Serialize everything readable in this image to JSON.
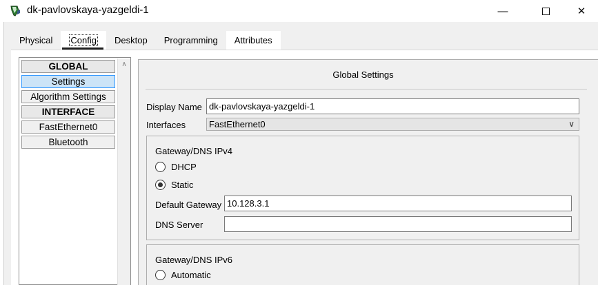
{
  "window": {
    "title": "dk-pavlovskaya-yazgeldi-1",
    "icon": "packet-tracer-pc-icon",
    "controls": {
      "minimize": "—",
      "close": "✕"
    }
  },
  "tabs": [
    {
      "label": "Physical",
      "active": false
    },
    {
      "label": "Config",
      "active": true
    },
    {
      "label": "Desktop",
      "active": false
    },
    {
      "label": "Programming",
      "active": false
    },
    {
      "label": "Attributes",
      "active": false
    }
  ],
  "nav": {
    "items": [
      {
        "label": "GLOBAL",
        "type": "header"
      },
      {
        "label": "Settings",
        "type": "item",
        "selected": true
      },
      {
        "label": "Algorithm Settings",
        "type": "item"
      },
      {
        "label": "INTERFACE",
        "type": "header"
      },
      {
        "label": "FastEthernet0",
        "type": "item"
      },
      {
        "label": "Bluetooth",
        "type": "item"
      }
    ],
    "scroll_up": "∧"
  },
  "settings": {
    "title": "Global Settings",
    "display_name_label": "Display Name",
    "display_name_value": "dk-pavlovskaya-yazgeldi-1",
    "interfaces_label": "Interfaces",
    "interfaces_value": "FastEthernet0",
    "chevron": "∨",
    "ipv4": {
      "title": "Gateway/DNS IPv4",
      "dhcp_label": "DHCP",
      "static_label": "Static",
      "mode": "Static",
      "gateway_label": "Default Gateway",
      "gateway_value": "10.128.3.1",
      "dns_label": "DNS Server",
      "dns_value": ""
    },
    "ipv6": {
      "title": "Gateway/DNS IPv6",
      "automatic_label": "Automatic"
    }
  },
  "colors": {
    "selected_bg": "#cce4f7",
    "selected_border": "#3399ff"
  }
}
